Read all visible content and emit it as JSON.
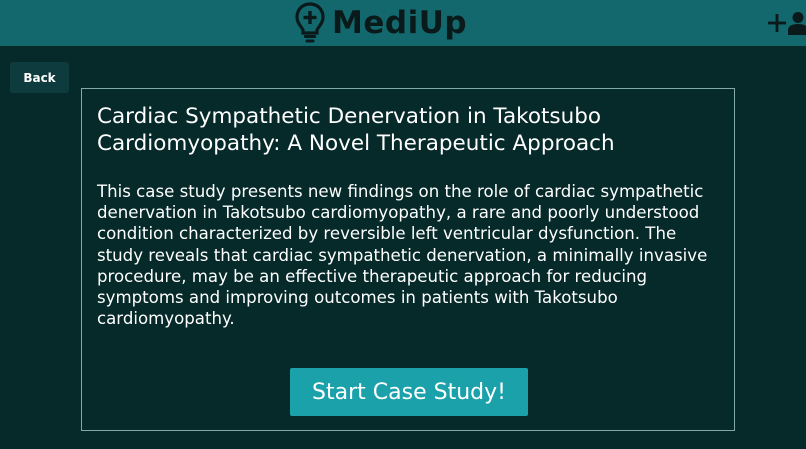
{
  "header": {
    "brand_name": "MediUp",
    "brand_icon": "lightbulb-plus-icon",
    "actions": [
      "add-icon",
      "user-icon"
    ]
  },
  "nav": {
    "back_label": "Back"
  },
  "case_study": {
    "title": "Cardiac Sympathetic Denervation in Takotsubo Cardiomyopathy: A Novel Therapeutic Approach",
    "description": "This case study presents new findings on the role of cardiac sympathetic denervation in Takotsubo cardiomyopathy, a rare and poorly understood condition characterized by reversible left ventricular dysfunction. The study reveals that cardiac sympathetic denervation, a minimally invasive procedure, may be an effective therapeutic approach for reducing symptoms and improving outcomes in patients with Takotsubo cardiomyopathy.",
    "start_label": "Start Case Study!"
  },
  "colors": {
    "background": "#06292a",
    "header": "#13686d",
    "accent_button": "#1ba1aa",
    "back_button": "#0e3b3d",
    "card_border": "#7fa9aa"
  }
}
